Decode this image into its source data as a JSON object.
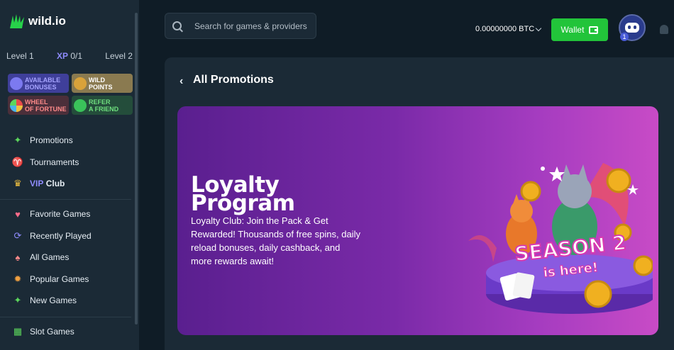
{
  "brand": {
    "name": "wild.io"
  },
  "levels": {
    "current": "Level 1",
    "xp_label": "XP",
    "xp_value": "0/1",
    "next": "Level 2"
  },
  "tiles": [
    {
      "line1": "Available",
      "line2": "Bonuses",
      "icon": "gift-icon"
    },
    {
      "line1": "Wild",
      "line2": "Points",
      "icon": "coin-stack-icon"
    },
    {
      "line1": "Wheel",
      "line2": "of Fortune",
      "icon": "wheel-icon"
    },
    {
      "line1": "Refer",
      "line2": "a Friend",
      "icon": "megaphone-icon"
    }
  ],
  "nav": {
    "promotions": "Promotions",
    "tournaments": "Tournaments",
    "vip_prefix": "VIP",
    "vip_suffix": "Club",
    "favorite_games": "Favorite Games",
    "recently_played": "Recently Played",
    "all_games": "All Games",
    "popular_games": "Popular Games",
    "new_games": "New Games",
    "slot_games": "Slot Games"
  },
  "search": {
    "placeholder": "Search for games & providers"
  },
  "header": {
    "balance": "0.00000000 BTC",
    "wallet_label": "Wallet",
    "avatar_badge": "1"
  },
  "page": {
    "title": "All Promotions"
  },
  "banner": {
    "title_line1": "Loyalty",
    "title_line2": "Program",
    "description": "Loyalty Club: Join the Pack & Get Rewarded! Thousands of free spins, daily reload bonuses, daily cashback, and more rewards await!",
    "art_line1": "SEASON 2",
    "art_line2": "is here!"
  },
  "colors": {
    "accent_green": "#22c43a",
    "accent_purple": "#8f8cff",
    "banner_start": "#5a1f8f",
    "banner_end": "#c84bc6"
  }
}
